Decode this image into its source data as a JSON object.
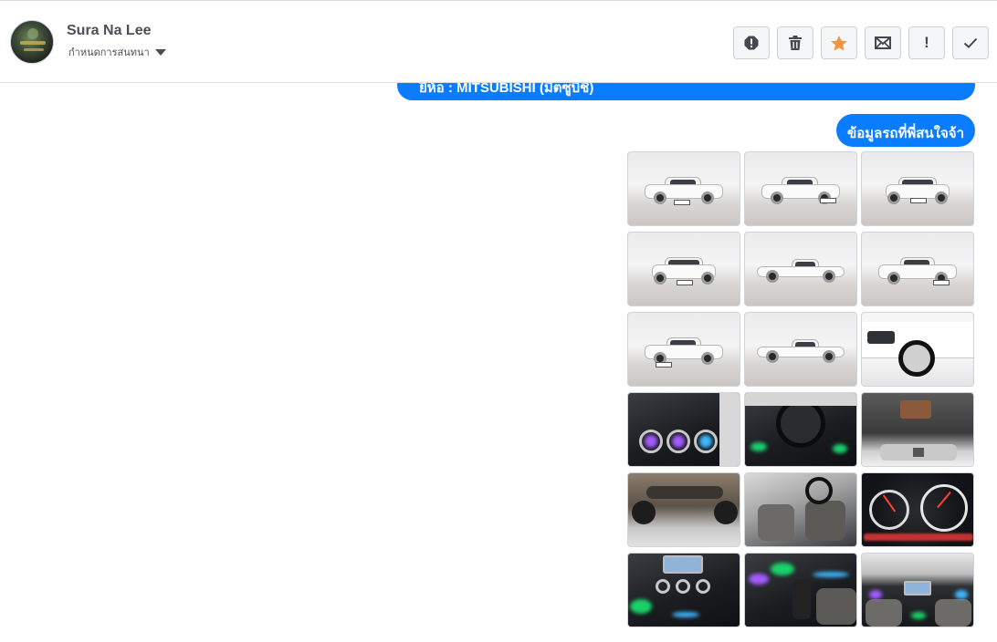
{
  "header": {
    "contact_name": "Sura Na Lee",
    "assign_label": "กำหนดการสนทนา",
    "toolbar": [
      {
        "icon": "alert-circle-icon",
        "name": "mark-spam-button"
      },
      {
        "icon": "trash-icon",
        "name": "delete-button"
      },
      {
        "icon": "star-icon",
        "name": "star-button",
        "color": "#f7923a"
      },
      {
        "icon": "envelope-icon",
        "name": "mark-unread-button"
      },
      {
        "icon": "exclamation-icon",
        "name": "follow-up-button",
        "glyph": "!"
      },
      {
        "icon": "check-icon",
        "name": "done-button"
      }
    ]
  },
  "messages": [
    {
      "id": "brand",
      "text": "ยี่ห้อ : MITSUBISHI (มิตซูบิชิ)"
    },
    {
      "id": "interest",
      "text": "ข้อมูลรถที่พี่สนใจจ้า"
    }
  ],
  "photos": [
    {
      "kind": "ext",
      "view": "front-3q"
    },
    {
      "kind": "ext",
      "view": "front-3q"
    },
    {
      "kind": "ext",
      "view": "front"
    },
    {
      "kind": "ext",
      "view": "rear"
    },
    {
      "kind": "ext",
      "view": "side"
    },
    {
      "kind": "ext",
      "view": "rear-3q"
    },
    {
      "kind": "ext",
      "view": "rear-3q"
    },
    {
      "kind": "ext",
      "view": "side"
    },
    {
      "kind": "ext",
      "view": "wheel-closeup"
    },
    {
      "kind": "int",
      "view": "door-speakers"
    },
    {
      "kind": "int",
      "view": "steering-wheel"
    },
    {
      "kind": "ext",
      "view": "engine-bay"
    },
    {
      "kind": "under",
      "view": "underbody"
    },
    {
      "kind": "int",
      "view": "seats"
    },
    {
      "kind": "gauge",
      "view": "gauge-cluster"
    },
    {
      "kind": "int",
      "view": "center-console"
    },
    {
      "kind": "int",
      "view": "gear-lever"
    },
    {
      "kind": "int",
      "view": "cabin-overview"
    }
  ],
  "colors": {
    "bubble": "#0a7cff",
    "star": "#f7923a"
  }
}
